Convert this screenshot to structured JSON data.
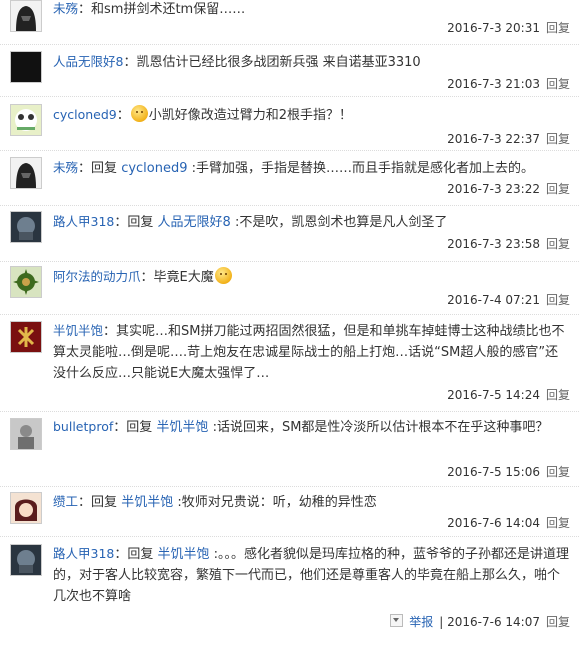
{
  "comments": [
    {
      "user": "未殇",
      "reply_word": "",
      "reply_to": "",
      "text": "：和sm拼剑术还tm保留……",
      "time": "2016-7-3 20:31",
      "reply": "回复",
      "report": ""
    },
    {
      "user": "人品无限好8",
      "reply_word": "",
      "reply_to": "",
      "text": "：凯恩估计已经比很多战团新兵强 来自诺基亚3310",
      "time": "2016-7-3 21:03",
      "reply": "回复",
      "report": ""
    },
    {
      "user": "cycloned9",
      "reply_word": "",
      "reply_to": "",
      "text": "小凯好像改造过臂力和2根手指？！",
      "time": "2016-7-3 22:37",
      "reply": "回复",
      "report": ""
    },
    {
      "user": "未殇",
      "reply_word": "回复",
      "reply_to": "cycloned9",
      "text": " :手臂加强，手指是替换……而且手指就是感化者加上去的。",
      "time": "2016-7-3 23:22",
      "reply": "回复",
      "report": ""
    },
    {
      "user": "路人甲318",
      "reply_word": "回复",
      "reply_to": "人品无限好8",
      "text": " :不是吹，凯恩剑术也算是凡人剑圣了",
      "time": "2016-7-3 23:58",
      "reply": "回复",
      "report": ""
    },
    {
      "user": "阿尔法的动力爪",
      "reply_word": "",
      "reply_to": "",
      "text": "：毕竟E大魔",
      "time": "2016-7-4 07:21",
      "reply": "回复",
      "report": ""
    },
    {
      "user": "半饥半饱",
      "reply_word": "",
      "reply_to": "",
      "text": "：其实呢…和SM拼刀能过两招固然很猛，但是和单挑车掉蛙博士这种战绩比也不算太灵能啦…倒是呢….苛上炮友在忠诚星际战士的船上打炮…话说“SM超人般的感官”还没什么反应…只能说E大魔太强悍了…",
      "time": "2016-7-5 14:24",
      "reply": "回复",
      "report": ""
    },
    {
      "user": "bulletprof",
      "reply_word": "回复",
      "reply_to": "半饥半饱",
      "text": " :话说回来，SM都是性冷淡所以估计根本不在乎这种事吧？",
      "time": "2016-7-5 15:06",
      "reply": "回复",
      "report": ""
    },
    {
      "user": "缵工",
      "reply_word": "回复",
      "reply_to": "半饥半饱",
      "text": " :牧师对兄贵说：听，幼稚的异性恋",
      "time": "2016-7-6 14:04",
      "reply": "回复",
      "report": ""
    },
    {
      "user": "路人甲318",
      "reply_word": "回复",
      "reply_to": "半饥半饱",
      "text": " :。。。感化者貌似是玛库拉格的种，蓝爷爷的子孙都还是讲道理的，对于客人比较宽容，繁殖下一代而已，他们还是尊重客人的毕竟在船上那么久，啪个几次也不算啥",
      "time": "2016-7-6 14:07",
      "reply": "回复",
      "report": "举报"
    }
  ]
}
